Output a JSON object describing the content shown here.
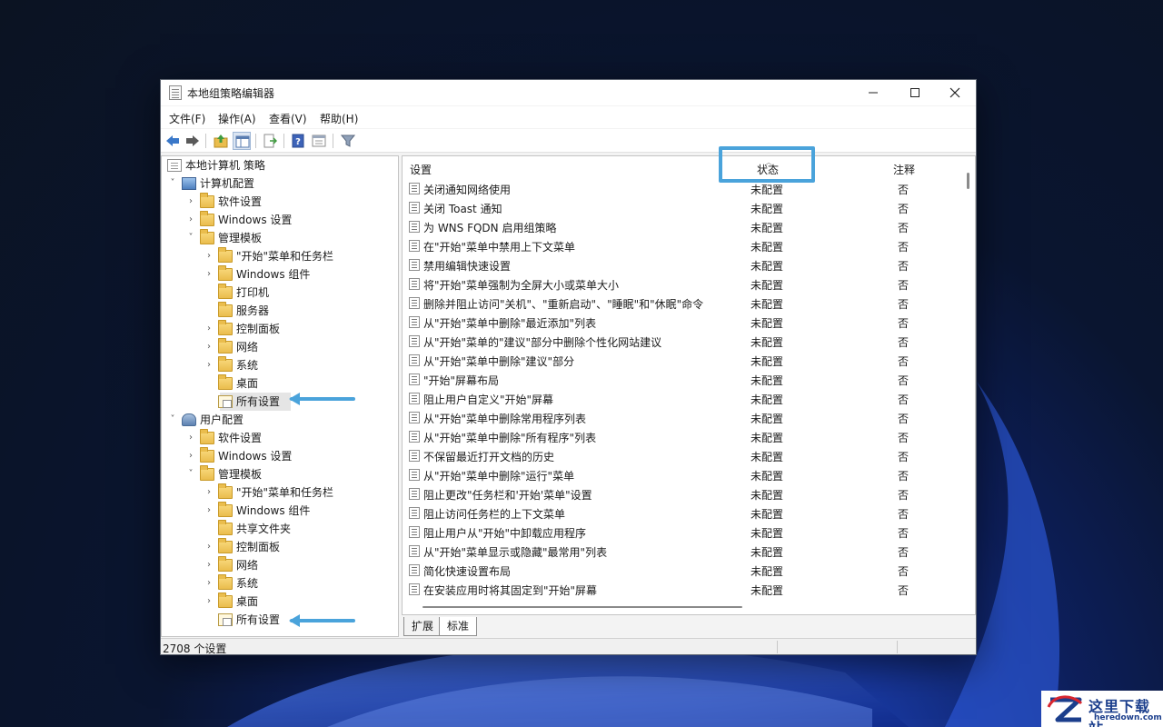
{
  "window": {
    "title": "本地组策略编辑器"
  },
  "menubar": [
    {
      "label": "文件(F)"
    },
    {
      "label": "操作(A)"
    },
    {
      "label": "查看(V)"
    },
    {
      "label": "帮助(H)"
    }
  ],
  "toolbar": {
    "buttons": [
      {
        "icon": "back-arrow-icon"
      },
      {
        "icon": "forward-arrow-icon"
      },
      {
        "icon": "up-folder-icon"
      },
      {
        "icon": "show-hide-tree-icon",
        "active": true
      },
      {
        "icon": "export-list-icon"
      },
      {
        "icon": "help-icon"
      },
      {
        "icon": "properties-icon"
      },
      {
        "icon": "filter-icon"
      }
    ]
  },
  "tree": [
    {
      "label": "本地计算机 策略",
      "level": 0,
      "icon": "doc",
      "arrow": ""
    },
    {
      "label": "计算机配置",
      "level": 1,
      "icon": "pc",
      "arrow": "v"
    },
    {
      "label": "软件设置",
      "level": 2,
      "icon": "folder",
      "arrow": ">"
    },
    {
      "label": "Windows 设置",
      "level": 2,
      "icon": "folder",
      "arrow": ">"
    },
    {
      "label": "管理模板",
      "level": 2,
      "icon": "folder",
      "arrow": "v"
    },
    {
      "label": "\"开始\"菜单和任务栏",
      "level": 3,
      "icon": "folder",
      "arrow": ">"
    },
    {
      "label": "Windows 组件",
      "level": 3,
      "icon": "folder",
      "arrow": ">"
    },
    {
      "label": "打印机",
      "level": 3,
      "icon": "folder",
      "arrow": ""
    },
    {
      "label": "服务器",
      "level": 3,
      "icon": "folder",
      "arrow": ""
    },
    {
      "label": "控制面板",
      "level": 3,
      "icon": "folder",
      "arrow": ">"
    },
    {
      "label": "网络",
      "level": 3,
      "icon": "folder",
      "arrow": ">"
    },
    {
      "label": "系统",
      "level": 3,
      "icon": "folder",
      "arrow": ">"
    },
    {
      "label": "桌面",
      "level": 3,
      "icon": "folder",
      "arrow": ""
    },
    {
      "label": "所有设置",
      "level": 3,
      "icon": "allset",
      "arrow": "",
      "selected": true,
      "annotated": true
    },
    {
      "label": "用户配置",
      "level": 1,
      "icon": "user",
      "arrow": "v"
    },
    {
      "label": "软件设置",
      "level": 2,
      "icon": "folder",
      "arrow": ">"
    },
    {
      "label": "Windows 设置",
      "level": 2,
      "icon": "folder",
      "arrow": ">"
    },
    {
      "label": "管理模板",
      "level": 2,
      "icon": "folder",
      "arrow": "v"
    },
    {
      "label": "\"开始\"菜单和任务栏",
      "level": 3,
      "icon": "folder",
      "arrow": ">"
    },
    {
      "label": "Windows 组件",
      "level": 3,
      "icon": "folder",
      "arrow": ">"
    },
    {
      "label": "共享文件夹",
      "level": 3,
      "icon": "folder",
      "arrow": ""
    },
    {
      "label": "控制面板",
      "level": 3,
      "icon": "folder",
      "arrow": ">"
    },
    {
      "label": "网络",
      "level": 3,
      "icon": "folder",
      "arrow": ">"
    },
    {
      "label": "系统",
      "level": 3,
      "icon": "folder",
      "arrow": ">"
    },
    {
      "label": "桌面",
      "level": 3,
      "icon": "folder",
      "arrow": ">"
    },
    {
      "label": "所有设置",
      "level": 3,
      "icon": "allset",
      "arrow": "",
      "annotated": true
    }
  ],
  "list": {
    "columns": {
      "setting": "设置",
      "state": "状态",
      "comment": "注释"
    },
    "rows": [
      {
        "name": "关闭通知网络使用",
        "state": "未配置",
        "comment": "否"
      },
      {
        "name": "关闭 Toast 通知",
        "state": "未配置",
        "comment": "否"
      },
      {
        "name": "为 WNS FQDN 启用组策略",
        "state": "未配置",
        "comment": "否"
      },
      {
        "name": "在\"开始\"菜单中禁用上下文菜单",
        "state": "未配置",
        "comment": "否"
      },
      {
        "name": "禁用编辑快速设置",
        "state": "未配置",
        "comment": "否"
      },
      {
        "name": "将\"开始\"菜单强制为全屏大小或菜单大小",
        "state": "未配置",
        "comment": "否"
      },
      {
        "name": "删除并阻止访问\"关机\"、\"重新启动\"、\"睡眠\"和\"休眠\"命令",
        "state": "未配置",
        "comment": "否"
      },
      {
        "name": "从\"开始\"菜单中删除\"最近添加\"列表",
        "state": "未配置",
        "comment": "否"
      },
      {
        "name": "从\"开始\"菜单的\"建议\"部分中删除个性化网站建议",
        "state": "未配置",
        "comment": "否"
      },
      {
        "name": "从\"开始\"菜单中删除\"建议\"部分",
        "state": "未配置",
        "comment": "否"
      },
      {
        "name": "\"开始\"屏幕布局",
        "state": "未配置",
        "comment": "否"
      },
      {
        "name": "阻止用户自定义\"开始\"屏幕",
        "state": "未配置",
        "comment": "否"
      },
      {
        "name": "从\"开始\"菜单中删除常用程序列表",
        "state": "未配置",
        "comment": "否"
      },
      {
        "name": "从\"开始\"菜单中删除\"所有程序\"列表",
        "state": "未配置",
        "comment": "否"
      },
      {
        "name": "不保留最近打开文档的历史",
        "state": "未配置",
        "comment": "否"
      },
      {
        "name": "从\"开始\"菜单中删除\"运行\"菜单",
        "state": "未配置",
        "comment": "否"
      },
      {
        "name": "阻止更改\"任务栏和'开始'菜单\"设置",
        "state": "未配置",
        "comment": "否"
      },
      {
        "name": "阻止访问任务栏的上下文菜单",
        "state": "未配置",
        "comment": "否"
      },
      {
        "name": "阻止用户从\"开始\"中卸载应用程序",
        "state": "未配置",
        "comment": "否"
      },
      {
        "name": "从\"开始\"菜单显示或隐藏\"最常用\"列表",
        "state": "未配置",
        "comment": "否"
      },
      {
        "name": "简化快速设置布局",
        "state": "未配置",
        "comment": "否"
      },
      {
        "name": "在安装应用时将其固定到\"开始\"屏幕",
        "state": "未配置",
        "comment": "否"
      }
    ]
  },
  "tabs": [
    {
      "label": "扩展",
      "active": false
    },
    {
      "label": "标准",
      "active": true
    }
  ],
  "status": {
    "text": "2708 个设置"
  },
  "watermark": {
    "cn": "这里下载站",
    "url": "heredown.com"
  },
  "colors": {
    "annotation": "#4aa3db",
    "watermark": "#1b3e8c"
  }
}
